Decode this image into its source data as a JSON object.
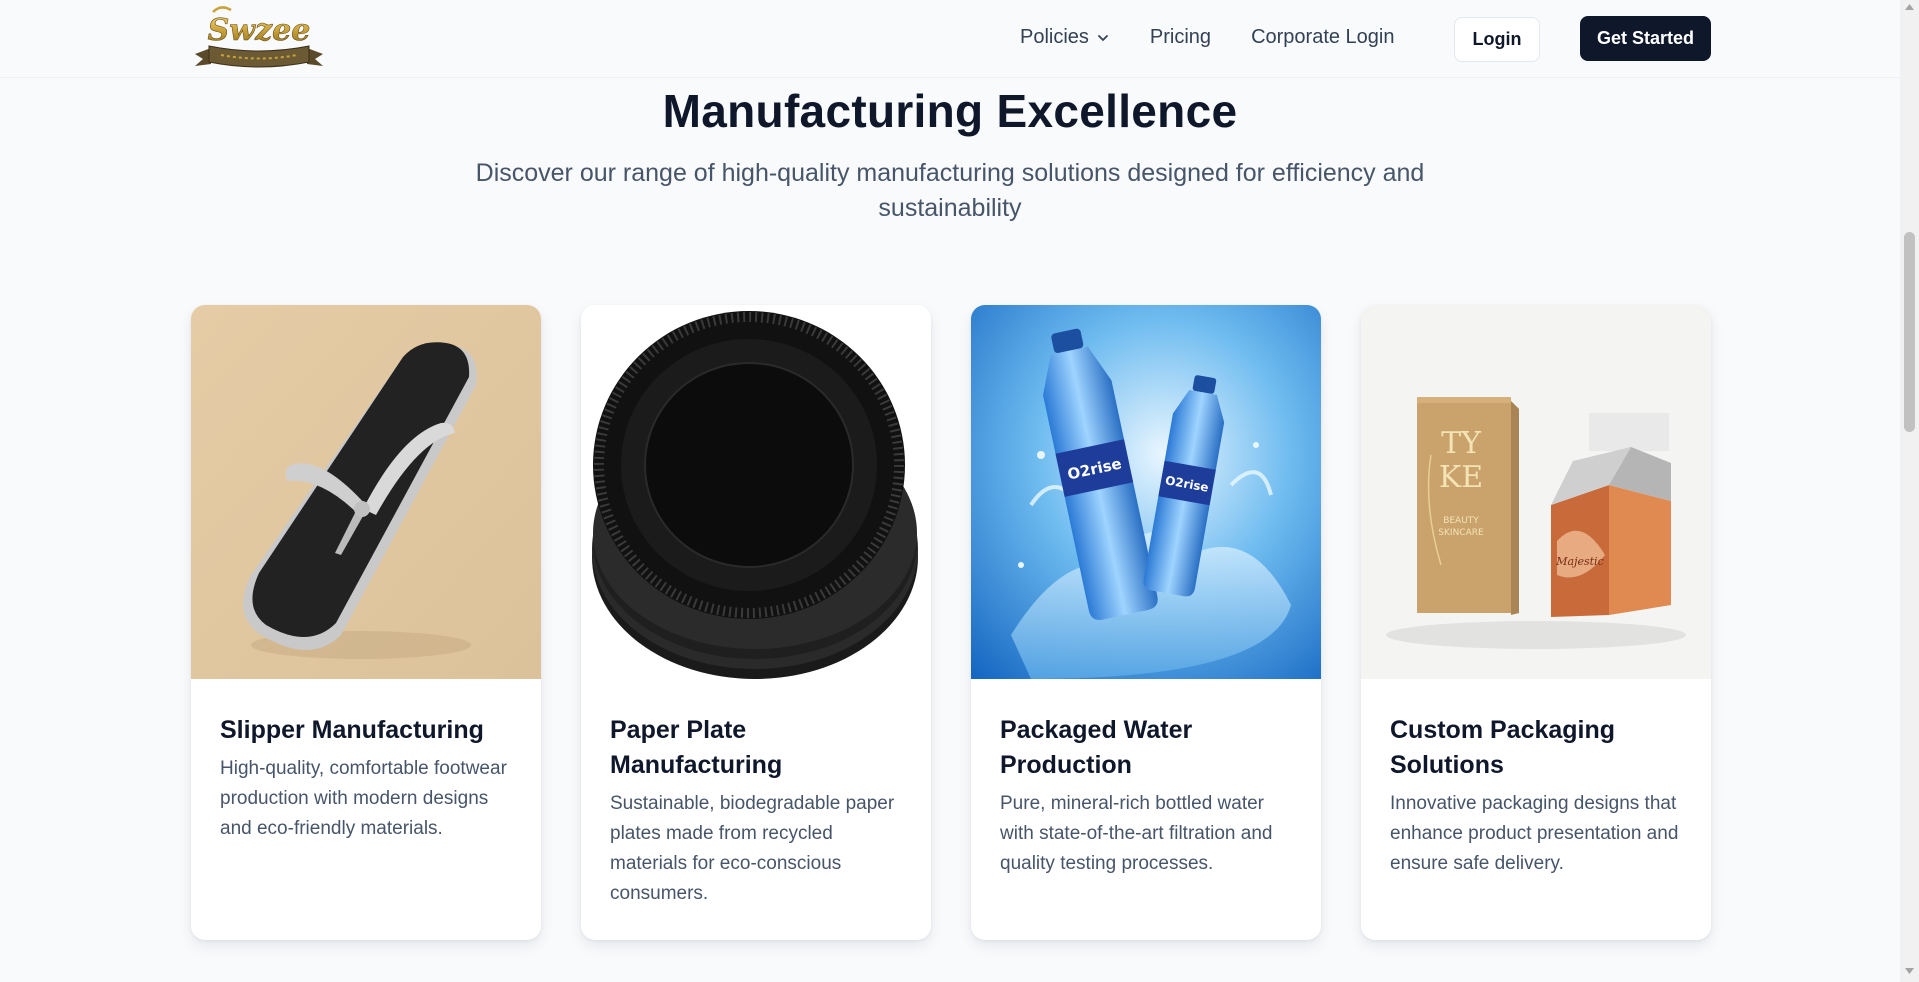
{
  "nav": {
    "logo_text": "Swzee",
    "links": [
      {
        "label": "Policies",
        "icon": "chevron-down-icon"
      },
      {
        "label": "Pricing"
      },
      {
        "label": "Corporate Login"
      }
    ],
    "login_label": "Login",
    "cta_label": "Get Started"
  },
  "section": {
    "title": "Manufacturing Excellence",
    "subtitle": "Discover our range of high-quality manufacturing solutions designed for efficiency and sustainability"
  },
  "cards": [
    {
      "title": "Slipper Manufacturing",
      "description": "High-quality, comfortable footwear production with modern designs and eco-friendly materials.",
      "image": "slipper-image"
    },
    {
      "title": "Paper Plate Manufacturing",
      "description": "Sustainable, biodegradable paper plates made from recycled materials for eco-conscious consumers.",
      "image": "paper-plate-image"
    },
    {
      "title": "Packaged Water Production",
      "description": "Pure, mineral-rich bottled water with state-of-the-art filtration and quality testing processes.",
      "image": "water-bottle-image"
    },
    {
      "title": "Custom Packaging Solutions",
      "description": "Innovative packaging designs that enhance product presentation and ensure safe delivery.",
      "image": "packaging-box-image"
    }
  ],
  "images": {
    "bottle_label": "O2rise",
    "box1_text_line1": "TY",
    "box1_text_line2": "KE",
    "box1_text_line3": "BEAUTY",
    "box1_text_line4": "SKINCARE",
    "box2_text": "Majestic"
  },
  "colors": {
    "primary_dark": "#0f172a",
    "text_muted": "#475569",
    "background": "#f8fafc",
    "logo_gold": "#c9a23a"
  }
}
